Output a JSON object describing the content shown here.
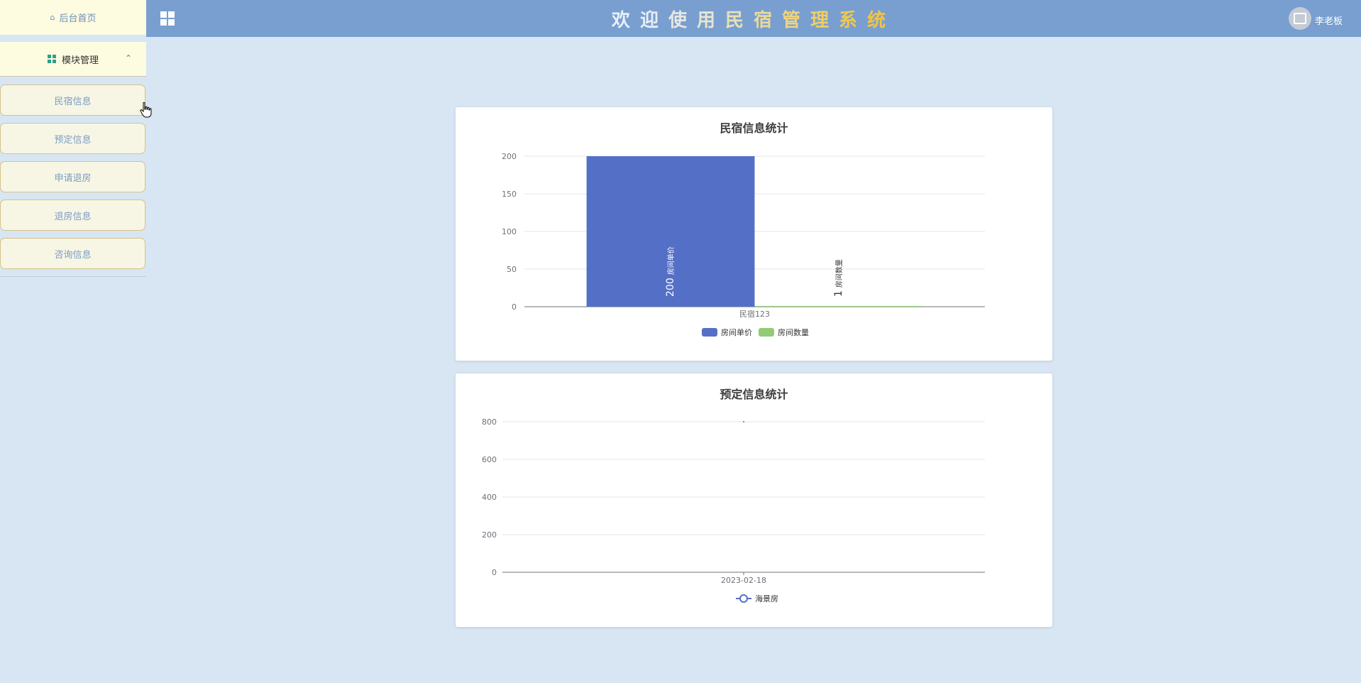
{
  "sidebar": {
    "home_label": "后台首页",
    "module_label": "模块管理",
    "items": [
      {
        "label": "民宿信息"
      },
      {
        "label": "预定信息"
      },
      {
        "label": "申请退房"
      },
      {
        "label": "退房信息"
      },
      {
        "label": "咨询信息"
      }
    ]
  },
  "header": {
    "welcome_chars": [
      "欢",
      "迎",
      "使",
      "用",
      "民",
      "宿",
      "管",
      "理",
      "系",
      "统"
    ],
    "user_name": "李老板"
  },
  "colors": {
    "header_bg": "#789fd0",
    "page_bg": "#d7e6f2",
    "sidebar_bg": "#fdfbe0",
    "bar_series_1": "#5470c6",
    "bar_series_2": "#91cc75",
    "line_series": "#5470c6"
  },
  "chart_data": [
    {
      "type": "bar",
      "title": "民宿信息统计",
      "categories": [
        "民宿123"
      ],
      "series": [
        {
          "name": "房间单价",
          "values": [
            200
          ]
        },
        {
          "name": "房间数量",
          "values": [
            1
          ]
        }
      ],
      "ylim": [
        0,
        200
      ],
      "yticks": [
        0,
        50,
        100,
        150,
        200
      ],
      "legend": "bottom-center",
      "grid": true
    },
    {
      "type": "line",
      "title": "预定信息统计",
      "x": [
        "2023-02-18"
      ],
      "series": [
        {
          "name": "海景房",
          "values": [
            800
          ]
        }
      ],
      "ylim": [
        0,
        800
      ],
      "yticks": [
        0,
        200,
        400,
        600,
        800
      ],
      "legend": "bottom-center",
      "grid": true
    }
  ]
}
